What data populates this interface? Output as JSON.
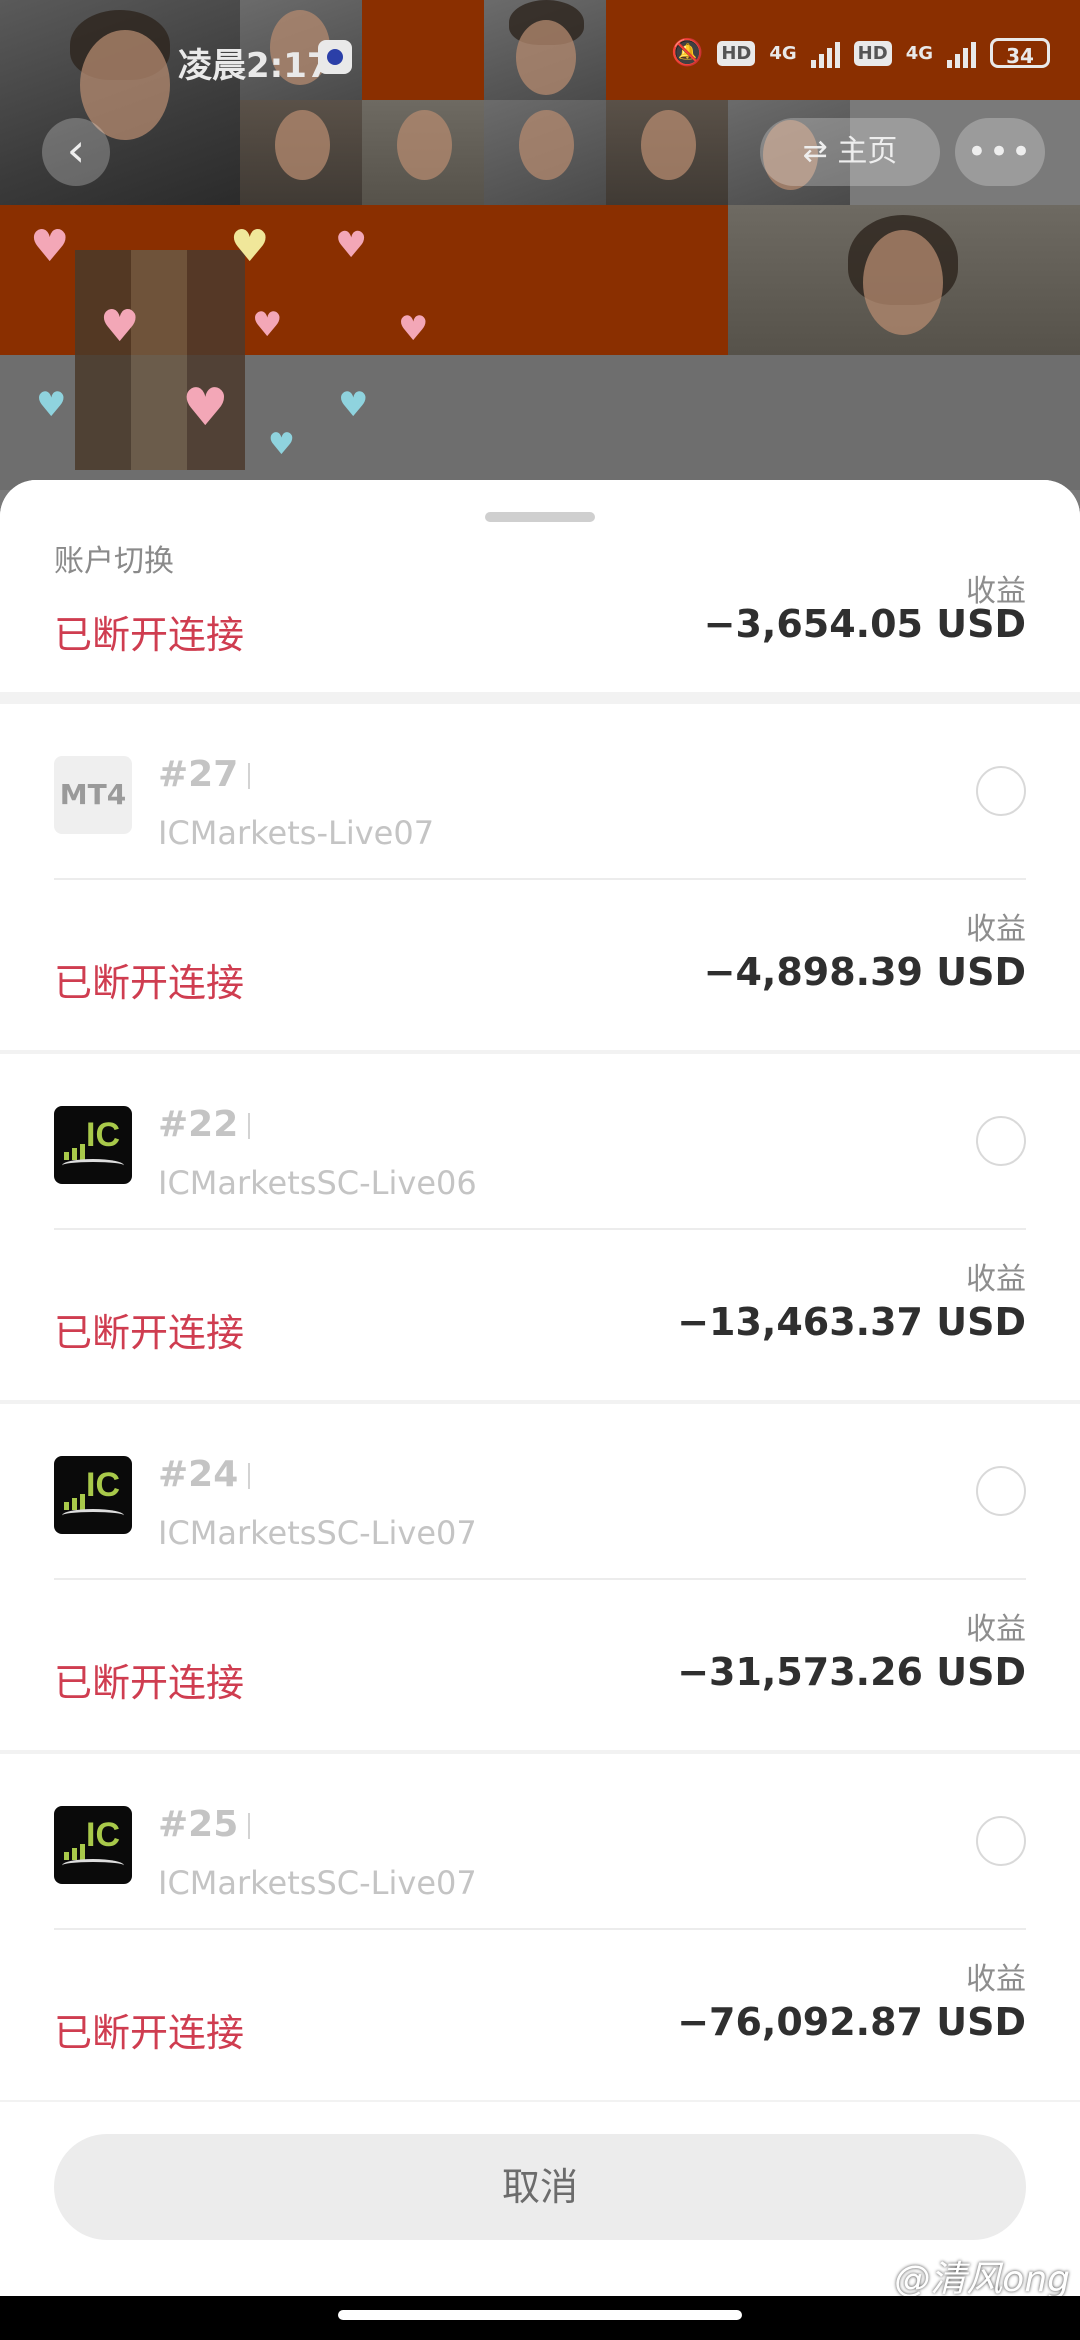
{
  "status_bar": {
    "time": "凌晨2:17",
    "net1": "4G",
    "net2": "4G",
    "hd1": "HD",
    "hd2": "HD",
    "battery": "34"
  },
  "background": {
    "back_icon": "‹",
    "home_label": "⇄ 主页",
    "more_icon": "•••",
    "heart_colors": [
      "#f3a7b7",
      "#f0e79a",
      "#8fd3de"
    ]
  },
  "sheet": {
    "title": "账户切换",
    "cancel_label": "取消"
  },
  "accounts": [
    {
      "number": "",
      "server": "",
      "profit_label": "收益",
      "status": "已断开连接",
      "amount": "−3,654.05 USD"
    },
    {
      "logo": "MT4",
      "number": "#27",
      "server": "ICMarkets-Live07",
      "profit_label": "收益",
      "status": "已断开连接",
      "amount": "−4,898.39 USD"
    },
    {
      "logo": "IC",
      "number": "#22",
      "server": "ICMarketsSC-Live06",
      "profit_label": "收益",
      "status": "已断开连接",
      "amount": "−13,463.37 USD"
    },
    {
      "logo": "IC",
      "number": "#24",
      "server": "ICMarketsSC-Live07",
      "profit_label": "收益",
      "status": "已断开连接",
      "amount": "−31,573.26 USD"
    },
    {
      "logo": "IC",
      "number": "#25",
      "server": "ICMarketsSC-Live07",
      "profit_label": "收益",
      "status": "已断开连接",
      "amount": "−76,092.87 USD"
    }
  ],
  "watermark": "@清风ong",
  "colors": {
    "disconnected": "#cf3d50",
    "amount": "#2f2f2f",
    "ic_green": "#a8c94a"
  }
}
